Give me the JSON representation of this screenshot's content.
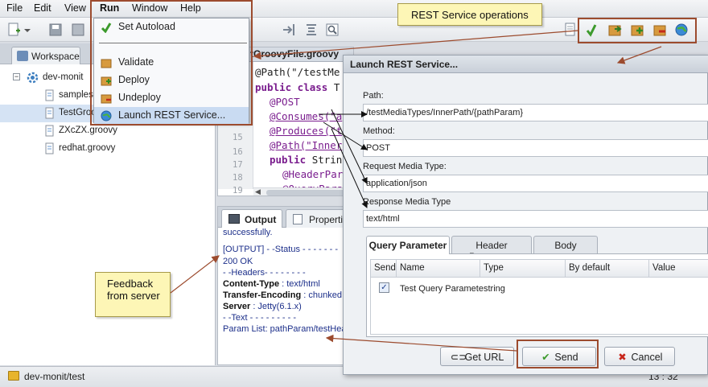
{
  "menubar": {
    "items": [
      "File",
      "Edit",
      "View",
      "Run",
      "Window",
      "Help"
    ]
  },
  "run_menu": {
    "items": [
      "Set Autoload",
      "Validate",
      "Deploy",
      "Undeploy",
      "Launch REST Service..."
    ]
  },
  "workspace_tab": "Workspace",
  "tree": {
    "root": "dev-monit",
    "items": [
      "samples",
      "TestGroo",
      "ZXcZX.groovy",
      "redhat.groovy"
    ]
  },
  "editor": {
    "tab_title": "tGroovyFile.groovy",
    "line_numbers": [
      "15",
      "16",
      "17",
      "18",
      "19"
    ],
    "lines": {
      "l1a": "@Path(\"/testMe",
      "l2kw": "public class ",
      "l2b": "T",
      "l3": "@POST",
      "l4": "@Consumes(\"a",
      "l5": "@Produces(\"t",
      "l6": "@Path(\"Inner",
      "l7kw": "public ",
      "l7b": "Strin",
      "l8": "@HeaderPar",
      "l9": "@QueryPara"
    }
  },
  "output_panel": {
    "tabs": [
      "Output",
      "Properties"
    ],
    "lines": [
      "successfully.",
      "[OUTPUT] - -Status - - - - - - -",
      "200 OK",
      "- -Headers- - - - - - - -",
      "Content-Type",
      " : text/html",
      "Transfer-Encoding",
      " : chunked",
      "Server",
      " : Jetty(6.1.x)",
      "- -Text - - - - - - - - -",
      "Param List: pathParam/testHea"
    ]
  },
  "dialog": {
    "title": "Launch REST Service...",
    "path_label": "Path:",
    "path_value": "/testMediaTypes/InnerPath/{pathParam}",
    "method_label": "Method:",
    "method_value": "POST",
    "request_label": "Request Media Type:",
    "request_value": "application/json",
    "response_label": "Response Media Type",
    "response_value": "text/html",
    "tabs": [
      "Query Parameter",
      "Header Parameter",
      "Body"
    ],
    "table": {
      "headers": [
        "Send",
        "Name",
        "Type",
        "By default",
        "Value"
      ],
      "row": {
        "checked": true,
        "name": "Test Query Paramete",
        "type": "string"
      }
    },
    "buttons": {
      "get_url": "Get URL",
      "send": "Send",
      "cancel": "Cancel"
    }
  },
  "callouts": {
    "rest_ops": "REST Service operations",
    "feedback": "Feedback from server"
  },
  "statusbar": {
    "path": "dev-monit/test",
    "position": "13 : 32"
  },
  "colors": {
    "callout_bg": "#fdf6b6",
    "highlight": "#9c4b2e",
    "selection": "#c9dbf2"
  }
}
